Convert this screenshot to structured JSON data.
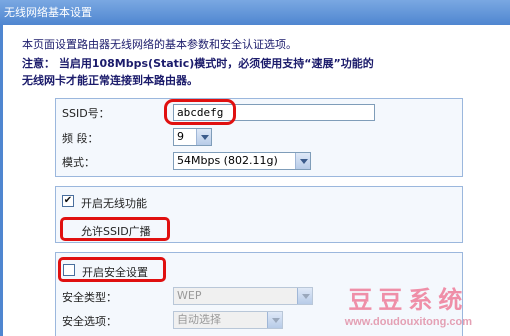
{
  "window": {
    "title": "无线网络基本设置"
  },
  "intro": "本页面设置路由器无线网络的基本参数和安全认证选项。",
  "notice": {
    "prefix": "注意：",
    "line1": "当启用108Mbps(Static)模式时，必须使用支持“速展”功能的",
    "line2": "无线网卡才能正常连接到本路由器。"
  },
  "basic": {
    "ssid_label": "SSID号：",
    "ssid_value": "abcdefg",
    "channel_label": "频 段：",
    "channel_value": "9",
    "mode_label": "模式：",
    "mode_value": "54Mbps (802.11g)"
  },
  "wireless": {
    "enable_label": "开启无线功能",
    "enable_checked": true,
    "broadcast_label": "允许SSID广播",
    "broadcast_checked": false
  },
  "security": {
    "enable_label": "开启安全设置",
    "enable_checked": false,
    "type_label": "安全类型：",
    "type_value": "WEP",
    "option_label": "安全选项：",
    "option_value": "自动选择"
  },
  "watermark": {
    "name": "豆豆系统",
    "url": "www.doudouxitong.com"
  },
  "colors": {
    "accent_red": "#e01010",
    "title_blue": "#4f86d0",
    "watermark_pink": "#ef8fa8"
  }
}
